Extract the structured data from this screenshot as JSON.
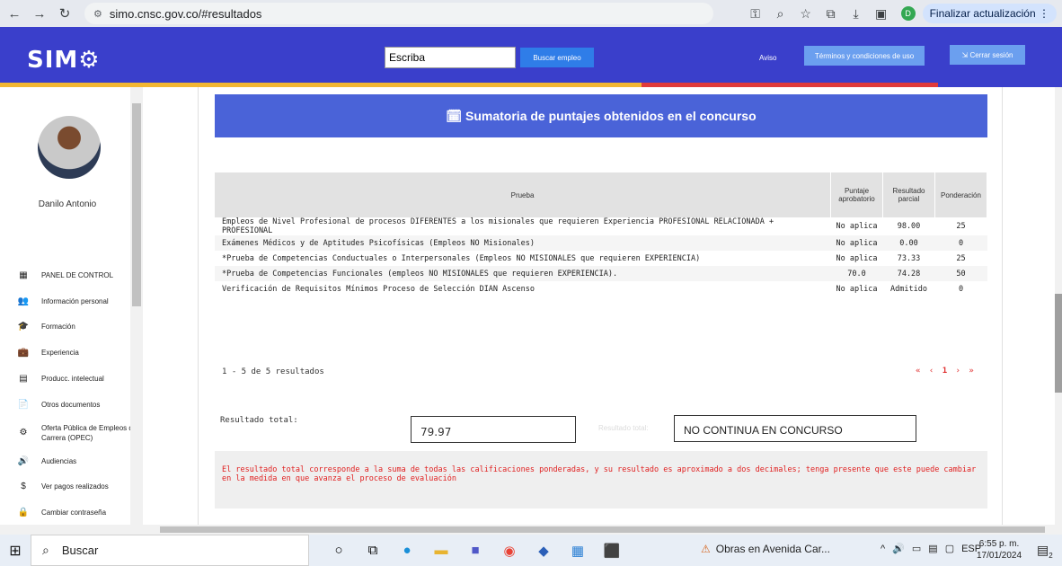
{
  "browser": {
    "url": "simo.cnsc.gov.co/#resultados",
    "profile_initial": "D",
    "update_label": "Finalizar actualización"
  },
  "header": {
    "logo": "SIM⚙",
    "search_value": "Escriba",
    "search_button": "Buscar empleo",
    "aviso": "Aviso",
    "terms": "Términos y condiciones de uso",
    "logout": "Cerrar sesión"
  },
  "sidebar": {
    "username": "Danilo Antonio",
    "items": [
      {
        "label": "PANEL DE CONTROL",
        "icon": "▦"
      },
      {
        "label": "Información personal",
        "icon": "👥"
      },
      {
        "label": "Formación",
        "icon": "🎓"
      },
      {
        "label": "Experiencia",
        "icon": "💼"
      },
      {
        "label": "Producc. intelectual",
        "icon": "▤"
      },
      {
        "label": "Otros documentos",
        "icon": "📄"
      },
      {
        "label": "Oferta Pública de Empleos de Carrera (OPEC)",
        "icon": "⚙"
      },
      {
        "label": "Audiencias",
        "icon": "🔊"
      },
      {
        "label": "Ver pagos realizados",
        "icon": "$"
      },
      {
        "label": "Cambiar contraseña",
        "icon": "🔒"
      }
    ]
  },
  "results": {
    "title": "Sumatoria de puntajes obtenidos en el concurso",
    "columns": {
      "prueba": "Prueba",
      "puntaje": "Puntaje aprobatorio",
      "resultado": "Resultado parcial",
      "ponderacion": "Ponderación"
    },
    "rows": [
      {
        "prueba": "Empleos de Nivel Profesional de procesos DIFERENTES a los misionales que requieren Experiencia PROFESIONAL RELACIONADA + PROFESIONAL",
        "puntaje": "No aplica",
        "resultado": "98.00",
        "ponderacion": "25"
      },
      {
        "prueba": "Exámenes Médicos y de Aptitudes Psicofísicas (Empleos NO Misionales)",
        "puntaje": "No aplica",
        "resultado": "0.00",
        "ponderacion": "0"
      },
      {
        "prueba": "*Prueba de Competencias Conductuales o Interpersonales (Empleos NO MISIONALES que requieren EXPERIENCIA)",
        "puntaje": "No aplica",
        "resultado": "73.33",
        "ponderacion": "25"
      },
      {
        "prueba": "*Prueba de Competencias Funcionales (empleos NO MISIONALES que requieren EXPERIENCIA).",
        "puntaje": "70.0",
        "resultado": "74.28",
        "ponderacion": "50"
      },
      {
        "prueba": "Verificación de Requisitos Mínimos Proceso de Selección DIAN Ascenso",
        "puntaje": "No aplica",
        "resultado": "Admitido",
        "ponderacion": "0"
      }
    ],
    "count_text": "1 - 5 de 5 resultados",
    "pager": {
      "first": "«",
      "prev": "‹",
      "page": "1",
      "next": "›",
      "last": "»"
    },
    "total_label": "Resultado total:",
    "total_value": "79.97",
    "total_ghost": "Resultado total:",
    "status": "NO CONTINUA EN CONCURSO",
    "note": "El resultado total corresponde a la suma de todas las calificaciones ponderadas, y su resultado es aproximado a dos decimales; tenga presente que este puede cambiar en la medida en que avanza el proceso de evaluación"
  },
  "taskbar": {
    "search": "Buscar",
    "weather": "Obras en Avenida Car...",
    "lang": "ESP",
    "time": "6:55 p. m.",
    "date": "17/01/2024",
    "notif_count": "2"
  },
  "colors": {
    "header": "#3a3fcb",
    "banner": "#4a63d8",
    "accent_blue": "#2f7de8",
    "error_red": "#e02020"
  }
}
